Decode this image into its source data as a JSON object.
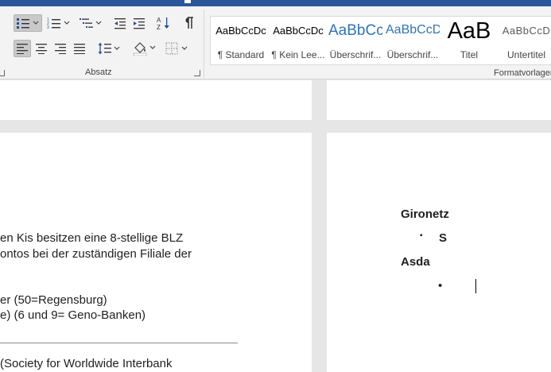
{
  "ribbon": {
    "groups": {
      "paragraph": "Absatz",
      "styles": "Formatvorlagen"
    },
    "icons": {
      "bullets": "bullets-icon",
      "numbering": "numbering-icon",
      "multilevel": "multilevel-list-icon",
      "decrease_indent": "decrease-indent-icon",
      "increase_indent": "increase-indent-icon",
      "sort": "sort-az-icon",
      "show_marks": "pilcrow-icon",
      "align_left": "align-left-icon",
      "center": "align-center-icon",
      "align_right": "align-right-icon",
      "justify": "justify-icon",
      "line_spacing": "line-spacing-icon",
      "shading": "shading-bucket-icon",
      "borders": "borders-icon"
    },
    "active_buttons": [
      "bullets",
      "align_left"
    ],
    "styles_gallery": [
      {
        "preview": "AaBbCcDc",
        "name": "¶ Standard",
        "color": "#000000"
      },
      {
        "preview": "AaBbCcDc",
        "name": "¶ Kein Lee...",
        "color": "#000000"
      },
      {
        "preview": "AaBbCc",
        "name": "Überschrif...",
        "color": "#2e74b5"
      },
      {
        "preview": "AaBbCcD",
        "name": "Überschrif...",
        "color": "#2e74b5"
      },
      {
        "preview": "AaB",
        "name": "Titel",
        "color": "#000000"
      },
      {
        "preview": "AaBbCcD",
        "name": "Untertitel",
        "color": "#595959"
      }
    ]
  },
  "document": {
    "left_page_lines": [
      "en Kis besitzen eine 8-stellige BLZ",
      "ontos bei der zuständigen Filiale der",
      "er (50=Regensburg)",
      "e) (6 und 9= Geno-Banken)",
      " (Society for Worldwide Interbank"
    ],
    "right_page": {
      "heading1": "Gironetz",
      "bullet1_marker": "▪",
      "bullet1_text": "S",
      "heading2": "Asda",
      "bullet2_marker": "•"
    }
  },
  "colors": {
    "title_bar": "#2b579a",
    "heading_style_blue": "#2e74b5",
    "page_background": "#ffffff",
    "canvas_background": "#e6e6e6"
  }
}
